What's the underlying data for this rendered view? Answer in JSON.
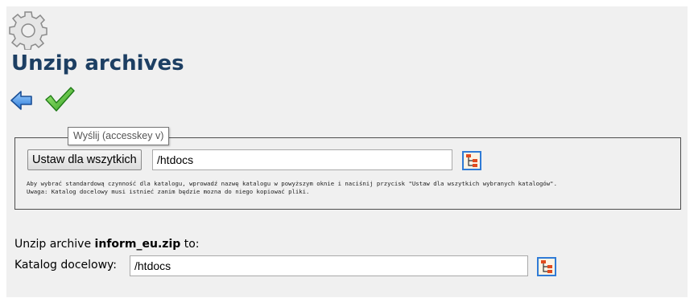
{
  "page": {
    "title": "Unzip archives"
  },
  "toolbar": {
    "back_icon": "back-arrow-icon",
    "confirm_icon": "checkmark-icon",
    "tooltip": "Wyślij (accesskey v)"
  },
  "defaults": {
    "set_all_label": "Ustaw dla wszytkich",
    "directory_value": "/htdocs",
    "help_line1": "Aby wybrać standardową czynność dla katalogu, wprowadź nazwę katalogu w powyższym oknie i naciśnij przycisk \"Ustaw dla wszytkich wybranych katalogów\".",
    "help_line2": "Uwaga: Katalog docelowy musi istnieć zanim będzie mozna do niego kopiować pliki.",
    "browse_icon": "folder-tree-icon"
  },
  "archive": {
    "prefix": "Unzip archive",
    "filename": "inform_eu.zip",
    "suffix": "to:",
    "target_label": "Katalog docelowy:",
    "target_value": "/htdocs",
    "browse_icon": "folder-tree-icon"
  },
  "colors": {
    "title": "#1d3f63",
    "panel_bg": "#f0f0f0",
    "accent_blue": "#2f7bd6",
    "check_green": "#3aa82a"
  }
}
